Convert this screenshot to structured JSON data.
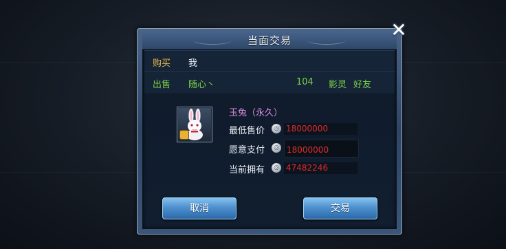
{
  "dialog": {
    "title": "当面交易"
  },
  "buyer": {
    "label": "购买",
    "name": "我"
  },
  "seller": {
    "label": "出售",
    "name": "随心丶",
    "level": "104",
    "guild": "影灵",
    "relation": "好友"
  },
  "item": {
    "name": "玉兔（永久）",
    "icon": "white-rabbit-pet"
  },
  "prices": [
    {
      "label": "最低售价",
      "value": "18000000"
    },
    {
      "label": "愿意支付",
      "value": "18000000"
    },
    {
      "label": "当前拥有",
      "value": "47482246"
    }
  ],
  "buttons": {
    "cancel": "取消",
    "trade": "交易"
  },
  "colors": {
    "buy_label": "#e6b84a",
    "sell_label": "#7ad04a",
    "item_name": "#d58ad8",
    "price": "#e12a2a"
  }
}
